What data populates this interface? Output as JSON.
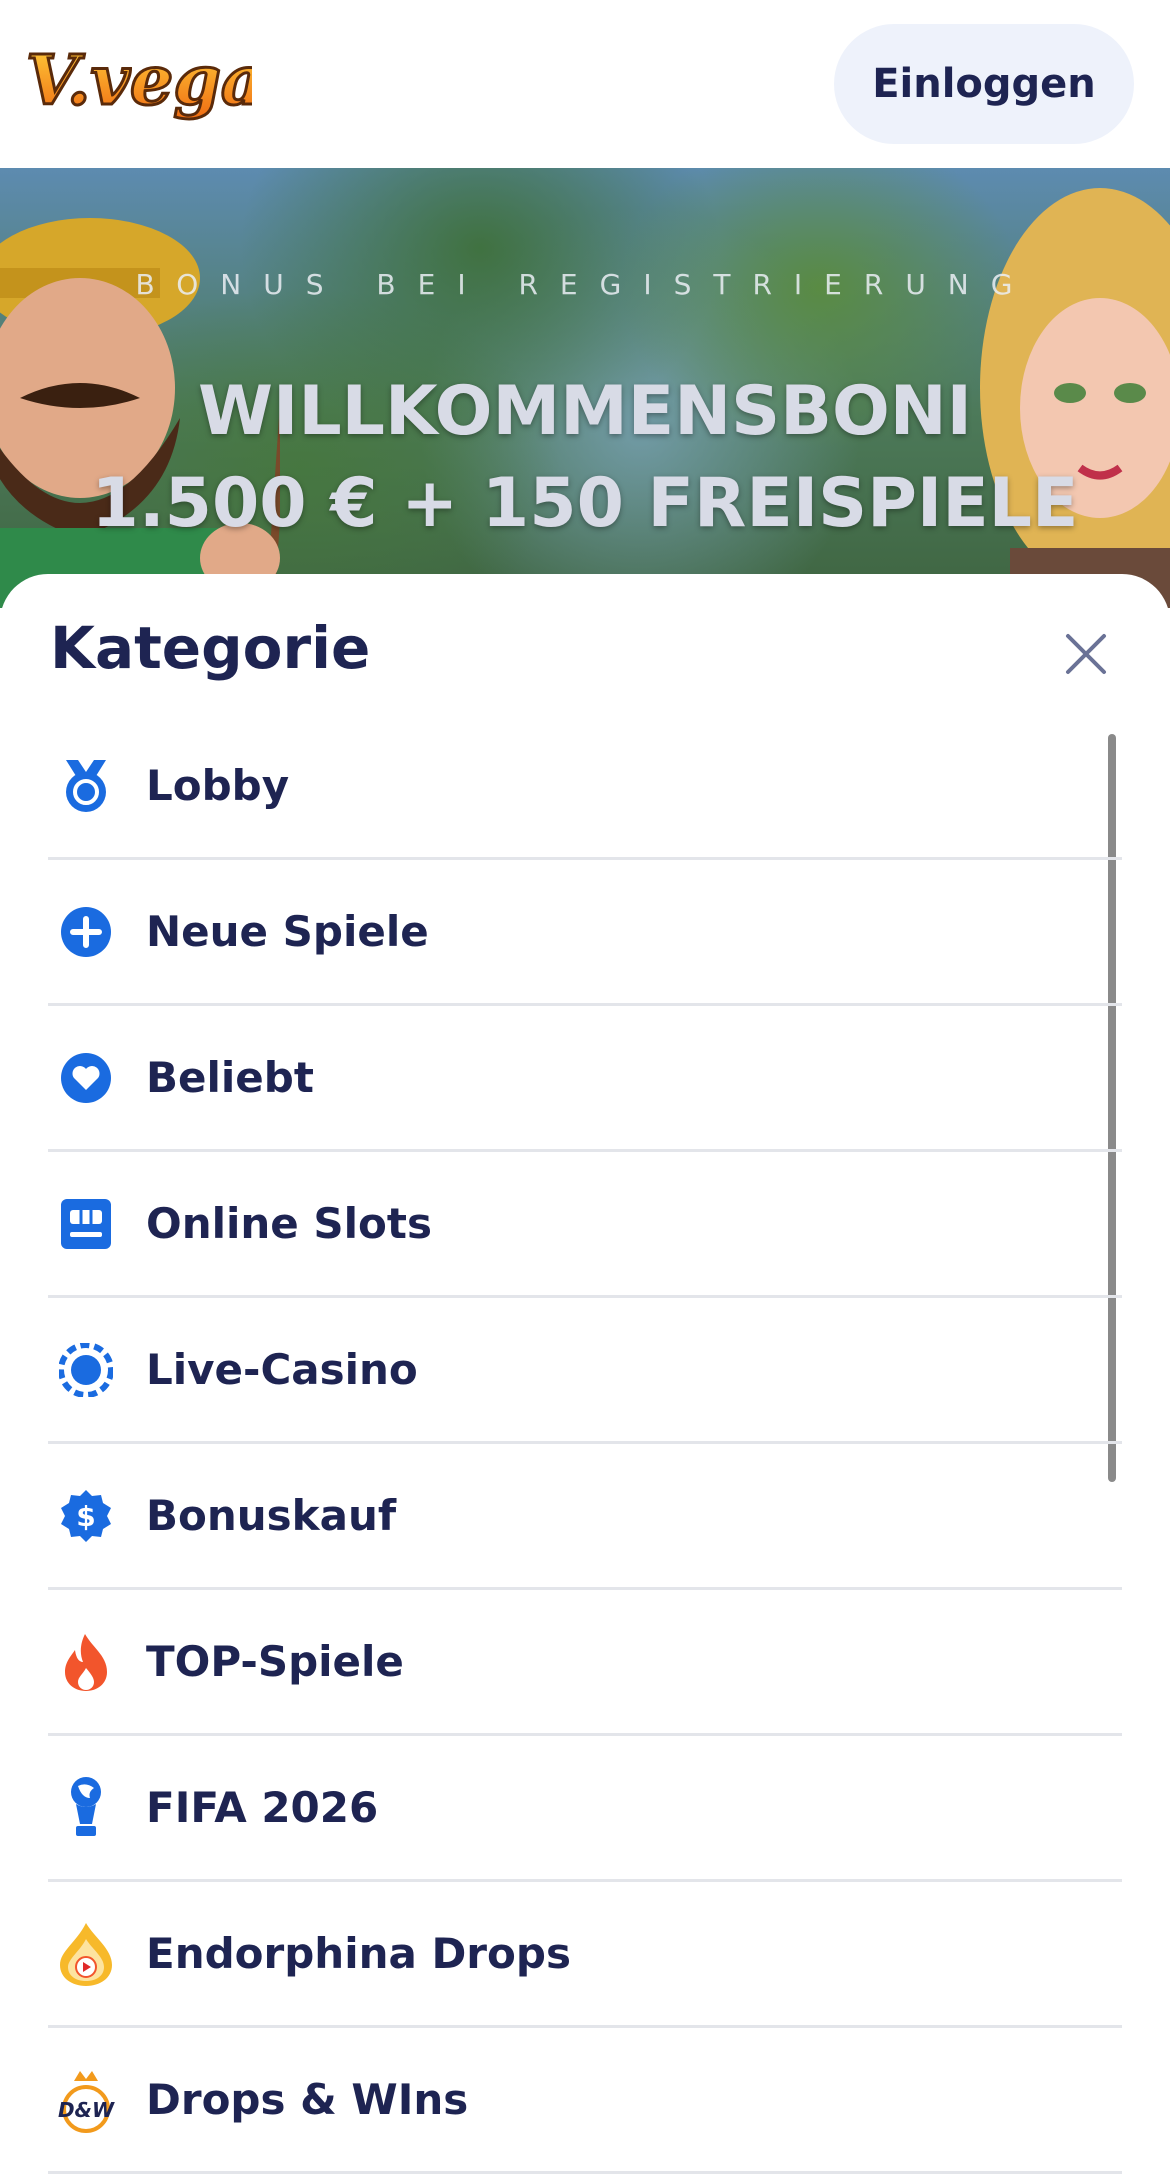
{
  "header": {
    "logo_text": "V.vegas",
    "login_label": "Einloggen"
  },
  "hero": {
    "subtitle": "BONUS BEI REGISTRIERUNG",
    "title_line1": "WILLKOMMENSBONI",
    "title_line2": "1.500 € + 150 FREISPIELE"
  },
  "drawer": {
    "title": "Kategorie",
    "items": [
      {
        "label": "Lobby",
        "icon": "medal-icon"
      },
      {
        "label": "Neue Spiele",
        "icon": "plus-circle-icon"
      },
      {
        "label": "Beliebt",
        "icon": "heart-circle-icon"
      },
      {
        "label": "Online Slots",
        "icon": "slot-machine-icon"
      },
      {
        "label": "Live-Casino",
        "icon": "casino-chip-icon"
      },
      {
        "label": "Bonuskauf",
        "icon": "dollar-badge-icon"
      },
      {
        "label": "TOP-Spiele",
        "icon": "flame-icon"
      },
      {
        "label": "FIFA 2026",
        "icon": "trophy-icon"
      },
      {
        "label": "Endorphina Drops",
        "icon": "endorphina-drop-icon"
      },
      {
        "label": "Drops & WIns",
        "icon": "drops-wins-icon"
      }
    ]
  },
  "colors": {
    "accent_blue": "#1a6be0",
    "text_dark": "#1e2452",
    "flame_orange": "#f2552c",
    "login_bg": "#eef2fb"
  }
}
